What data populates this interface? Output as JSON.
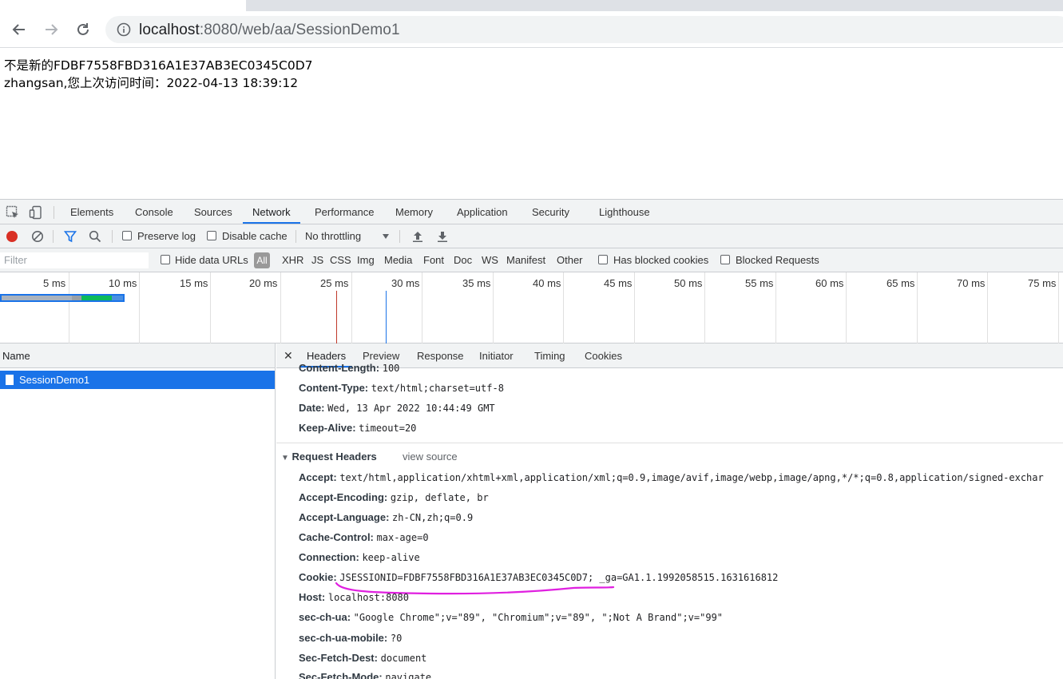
{
  "browser": {
    "url_host": "localhost",
    "url_rest": ":8080/web/aa/SessionDemo1"
  },
  "page": {
    "line1": "不是新的FDBF7558FBD316A1E37AB3EC0345C0D7",
    "line2": "zhangsan,您上次访问时间：2022-04-13 18:39:12"
  },
  "devtools": {
    "tabs": [
      "Elements",
      "Console",
      "Sources",
      "Network",
      "Performance",
      "Memory",
      "Application",
      "Security",
      "Lighthouse"
    ],
    "network_toolbar": {
      "preserve_log": "Preserve log",
      "disable_cache": "Disable cache",
      "throttling": "No throttling"
    },
    "filter": {
      "placeholder": "Filter",
      "hide_data_urls": "Hide data URLs",
      "all": "All",
      "types": [
        "XHR",
        "JS",
        "CSS",
        "Img",
        "Media",
        "Font",
        "Doc",
        "WS",
        "Manifest",
        "Other"
      ],
      "has_blocked_cookies": "Has blocked cookies",
      "blocked_requests": "Blocked Requests"
    },
    "timeline_ticks": [
      "5 ms",
      "10 ms",
      "15 ms",
      "20 ms",
      "25 ms",
      "30 ms",
      "35 ms",
      "40 ms",
      "45 ms",
      "50 ms",
      "55 ms",
      "60 ms",
      "65 ms",
      "70 ms",
      "75 ms"
    ],
    "name_header": "Name",
    "request_name": "SessionDemo1",
    "detail_tabs": [
      "Headers",
      "Preview",
      "Response",
      "Initiator",
      "Timing",
      "Cookies"
    ],
    "response_headers": [
      {
        "key": "Content-Length:",
        "value": "100"
      },
      {
        "key": "Content-Type:",
        "value": "text/html;charset=utf-8"
      },
      {
        "key": "Date:",
        "value": "Wed, 13 Apr 2022 10:44:49 GMT"
      },
      {
        "key": "Keep-Alive:",
        "value": "timeout=20"
      }
    ],
    "request_headers_title": "Request Headers",
    "view_source": "view source",
    "request_headers": [
      {
        "key": "Accept:",
        "value": "text/html,application/xhtml+xml,application/xml;q=0.9,image/avif,image/webp,image/apng,*/*;q=0.8,application/signed-exchar"
      },
      {
        "key": "Accept-Encoding:",
        "value": "gzip, deflate, br"
      },
      {
        "key": "Accept-Language:",
        "value": "zh-CN,zh;q=0.9"
      },
      {
        "key": "Cache-Control:",
        "value": "max-age=0"
      },
      {
        "key": "Connection:",
        "value": "keep-alive"
      },
      {
        "key": "Cookie:",
        "value": "JSESSIONID=FDBF7558FBD316A1E37AB3EC0345C0D7; _ga=GA1.1.1992058515.1631616812"
      },
      {
        "key": "Host:",
        "value": "localhost:8080"
      },
      {
        "key": "sec-ch-ua:",
        "value": "\"Google Chrome\";v=\"89\", \"Chromium\";v=\"89\", \";Not A Brand\";v=\"99\""
      },
      {
        "key": "sec-ch-ua-mobile:",
        "value": "?0"
      },
      {
        "key": "Sec-Fetch-Dest:",
        "value": "document"
      },
      {
        "key": "Sec-Fetch-Mode:",
        "value": "navigate"
      }
    ],
    "colors": {
      "accent": "#1a73e8",
      "record": "#d93025",
      "annotation": "#e020e0"
    }
  }
}
